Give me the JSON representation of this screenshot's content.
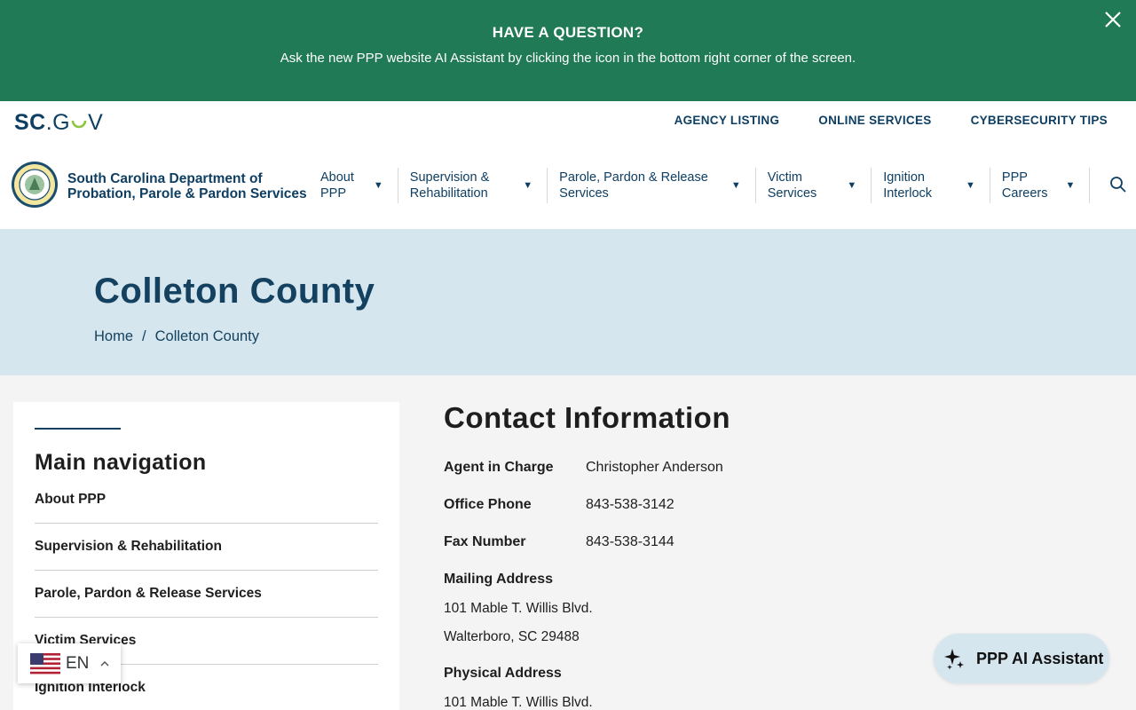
{
  "banner": {
    "title": "HAVE A QUESTION?",
    "text": "Ask the new PPP website AI Assistant by clicking the icon in the bottom right corner of the screen."
  },
  "header": {
    "scgov_bold": "SC",
    "scgov_rest": ".G",
    "scgov_end": "V",
    "util_links": [
      "AGENCY LISTING",
      "ONLINE SERVICES",
      "CYBERSECURITY TIPS"
    ],
    "logo_line1": "South Carolina Department of",
    "logo_line2": "Probation, Parole & Pardon Services",
    "nav": [
      {
        "line1": "About",
        "line2": "PPP"
      },
      {
        "line1": "Supervision &",
        "line2": "Rehabilitation"
      },
      {
        "line1": "Parole, Pardon & Release",
        "line2": "Services"
      },
      {
        "line1": "Victim",
        "line2": "Services"
      },
      {
        "line1": "Ignition",
        "line2": "Interlock"
      },
      {
        "line1": "PPP",
        "line2": "Careers"
      }
    ]
  },
  "hero": {
    "title": "Colleton County",
    "breadcrumb": {
      "home": "Home",
      "sep": "/",
      "current": "Colleton County"
    }
  },
  "sidebar": {
    "title": "Main navigation",
    "items": [
      "About PPP",
      "Supervision & Rehabilitation",
      "Parole, Pardon & Release Services",
      "Victim Services",
      "Ignition Interlock"
    ]
  },
  "contact": {
    "title": "Contact Information",
    "agent_label": "Agent in Charge",
    "agent_value": "Christopher Anderson",
    "phone_label": "Office Phone",
    "phone_value": "843-538-3142",
    "fax_label": "Fax Number",
    "fax_value": "843-538-3144",
    "mailing_label": "Mailing Address",
    "mailing_line1": "101 Mable T. Willis Blvd.",
    "mailing_line2": "Walterboro, SC 29488",
    "physical_label": "Physical Address",
    "physical_line1": "101 Mable T. Willis Blvd."
  },
  "language": {
    "code": "EN"
  },
  "ai_assistant": {
    "label": "PPP AI Assistant"
  },
  "colors": {
    "banner": "#1f7a55",
    "navy": "#0e3f63",
    "hero": "#d5e6ee"
  }
}
